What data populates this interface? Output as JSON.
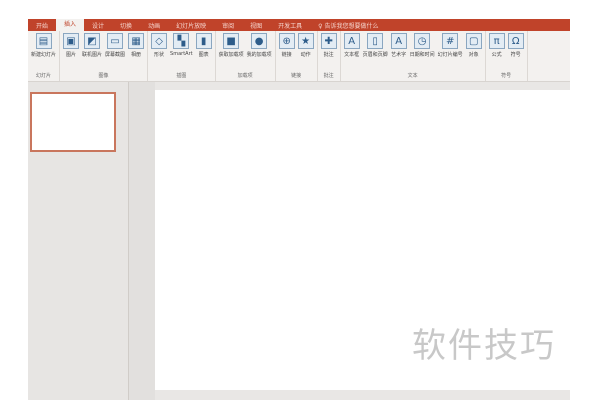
{
  "tabs": [
    "开始",
    "插入",
    "设计",
    "切换",
    "动画",
    "幻灯片放映",
    "审阅",
    "视图",
    "开发工具",
    "♀ 告诉我您想要做什么"
  ],
  "active_tab": 1,
  "groups": [
    {
      "label": "幻灯片",
      "items": [
        {
          "label": "新建幻灯片",
          "icon": "▤"
        }
      ]
    },
    {
      "label": "图像",
      "items": [
        {
          "label": "图片",
          "icon": "▣"
        },
        {
          "label": "联机图片",
          "icon": "◩"
        },
        {
          "label": "屏幕截图",
          "icon": "▭"
        },
        {
          "label": "相册",
          "icon": "▦"
        }
      ]
    },
    {
      "label": "插图",
      "items": [
        {
          "label": "形状",
          "icon": "◇"
        },
        {
          "label": "SmartArt",
          "icon": "▚"
        },
        {
          "label": "图表",
          "icon": "▮"
        }
      ]
    },
    {
      "label": "加载项",
      "items": [
        {
          "label": "获取加载项",
          "icon": "■"
        },
        {
          "label": "我的加载项",
          "icon": "●"
        }
      ]
    },
    {
      "label": "链接",
      "items": [
        {
          "label": "链接",
          "icon": "⊕"
        },
        {
          "label": "动作",
          "icon": "★"
        }
      ]
    },
    {
      "label": "批注",
      "items": [
        {
          "label": "批注",
          "icon": "✚"
        }
      ]
    },
    {
      "label": "文本",
      "items": [
        {
          "label": "文本框",
          "icon": "A"
        },
        {
          "label": "页眉和页脚",
          "icon": "▯"
        },
        {
          "label": "艺术字",
          "icon": "A"
        },
        {
          "label": "日期和时间",
          "icon": "◷"
        },
        {
          "label": "幻灯片编号",
          "icon": "#"
        },
        {
          "label": "对象",
          "icon": "▢"
        }
      ]
    },
    {
      "label": "符号",
      "items": [
        {
          "label": "公式",
          "icon": "π"
        },
        {
          "label": "符号",
          "icon": "Ω"
        }
      ]
    }
  ],
  "watermark": "软件技巧"
}
